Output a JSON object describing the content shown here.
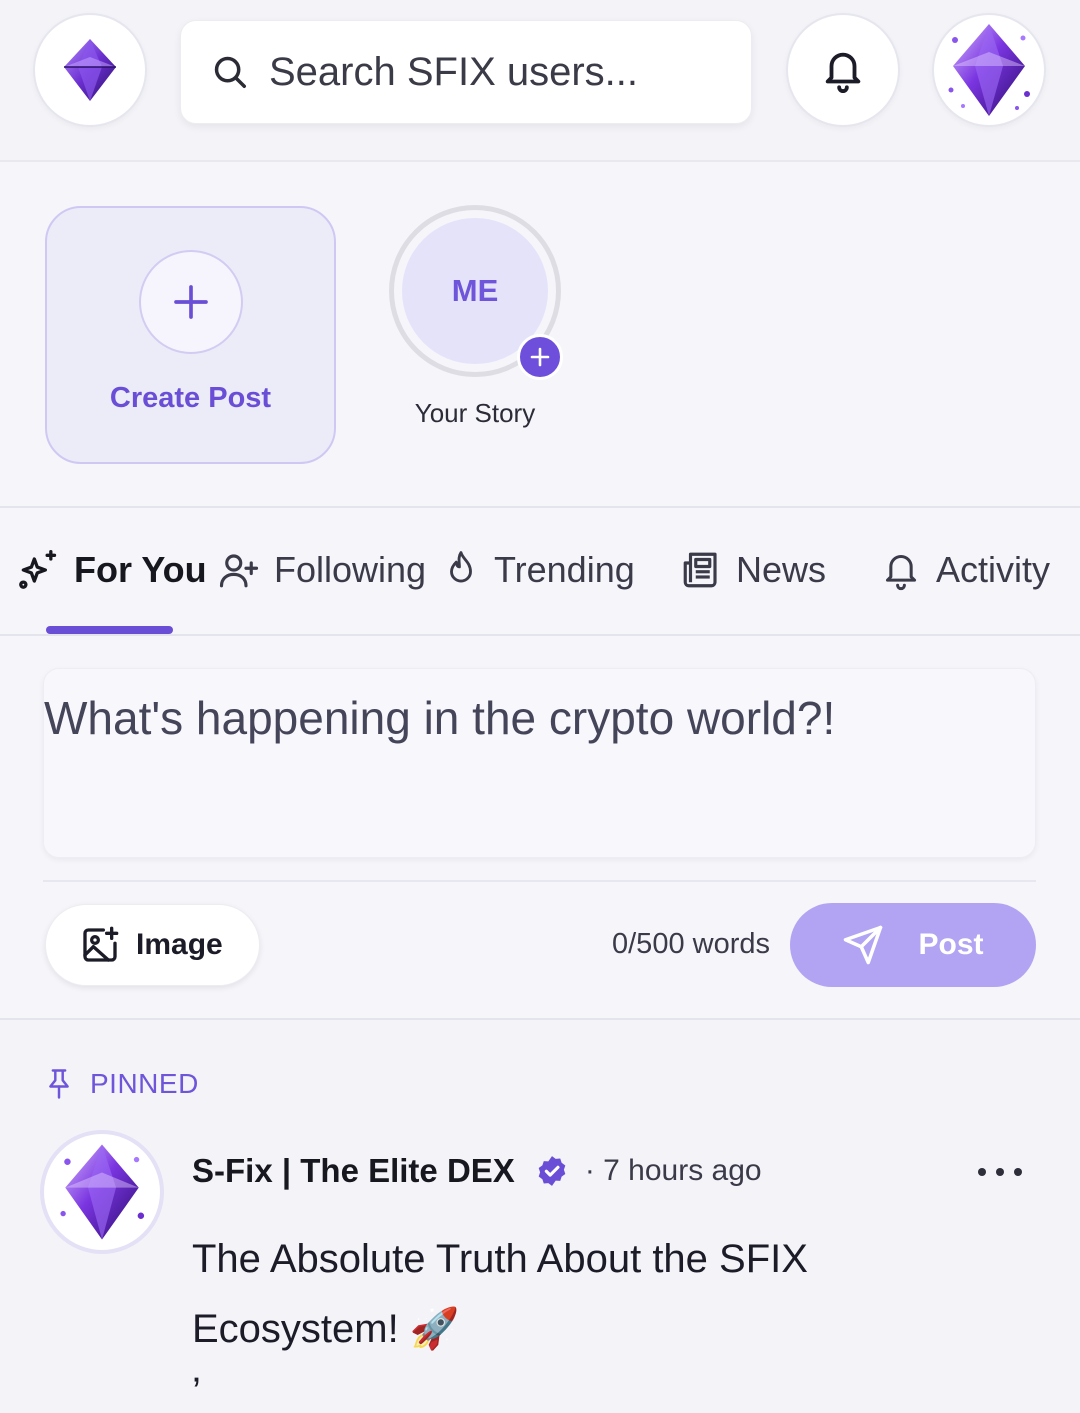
{
  "search": {
    "placeholder": "Search SFIX users..."
  },
  "stories": {
    "create_label": "Create Post",
    "me_initials": "ME",
    "your_story_label": "Your Story"
  },
  "tabs": [
    {
      "label": "For You",
      "icon": "sparkles-icon",
      "active": true
    },
    {
      "label": "Following",
      "icon": "user-plus-icon",
      "active": false
    },
    {
      "label": "Trending",
      "icon": "flame-icon",
      "active": false
    },
    {
      "label": "News",
      "icon": "newspaper-icon",
      "active": false
    },
    {
      "label": "Activity",
      "icon": "bell-icon",
      "active": false
    }
  ],
  "composer": {
    "placeholder": "What's happening in the crypto world?!",
    "image_label": "Image",
    "word_count": "0/500 words",
    "post_label": "Post"
  },
  "feed": {
    "pinned_label": "PINNED",
    "post": {
      "author": "S-Fix | The Elite DEX",
      "verified": true,
      "time": "· 7 hours ago",
      "text": "The Absolute Truth About the SFIX Ecosystem! 🚀",
      "text_extra": "’"
    }
  },
  "colors": {
    "accent": "#6a4fd6",
    "post_button_disabled": "#b2a4f2",
    "background": "#f4f4fa"
  }
}
